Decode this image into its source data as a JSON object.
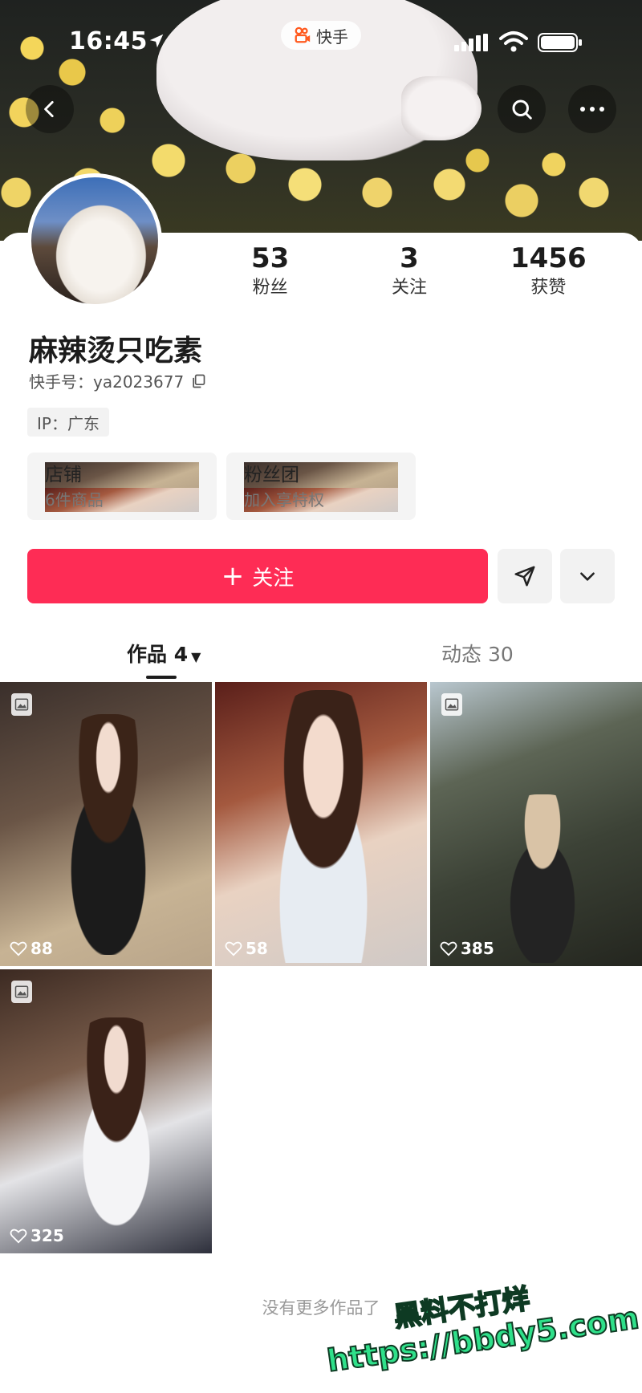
{
  "status_bar": {
    "time": "16:45",
    "app_name": "快手"
  },
  "profile": {
    "name": "麻辣烫只吃素",
    "uid_label": "快手号：ya2023677",
    "ip": "IP：广东"
  },
  "stats": [
    {
      "num": "53",
      "label": "粉丝"
    },
    {
      "num": "3",
      "label": "关注"
    },
    {
      "num": "1456",
      "label": "获赞"
    }
  ],
  "info_boxes": [
    {
      "title": "店铺",
      "sub": "6件商品"
    },
    {
      "title": "粉丝团",
      "sub": "加入享特权"
    }
  ],
  "actions": {
    "follow_label": "关注",
    "follow_plus": "+"
  },
  "tabs": [
    {
      "label": "作品 4",
      "active": true
    },
    {
      "label": "动态 30",
      "active": false
    }
  ],
  "works": [
    {
      "likes": "88"
    },
    {
      "likes": "58"
    },
    {
      "likes": "385"
    },
    {
      "likes": "325"
    }
  ],
  "footer": {
    "no_more": "没有更多作品了"
  },
  "watermark": {
    "line1": "黑料不打烊",
    "line2": "https://bbdy5.com"
  },
  "colors": {
    "accent": "#fe2c55"
  }
}
